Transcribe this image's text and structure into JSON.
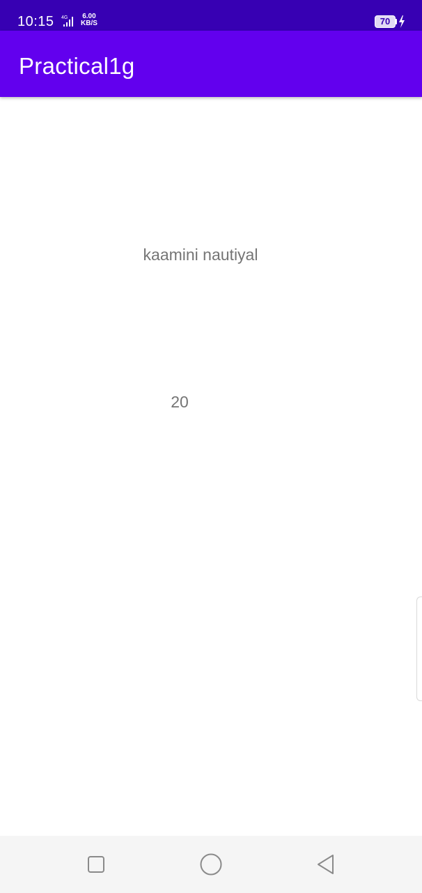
{
  "status_bar": {
    "time": "10:15",
    "network_type": "4G",
    "speed_value": "6.00",
    "speed_unit": "KB/S",
    "battery_level": "70",
    "icons": [
      "signal-icon",
      "battery-icon",
      "charging-bolt-icon"
    ]
  },
  "app_bar": {
    "title": "Practical1g",
    "color": "#6200ee"
  },
  "content": {
    "name_text": "kaamini nautiyal",
    "value_text": "20"
  },
  "nav_bar": {
    "buttons": [
      "recents-icon",
      "home-icon",
      "back-icon"
    ]
  },
  "colors": {
    "status_bar": "#3700b3",
    "app_bar": "#6200ee",
    "body_text": "#757575",
    "nav_bar_bg": "#f5f5f5"
  }
}
